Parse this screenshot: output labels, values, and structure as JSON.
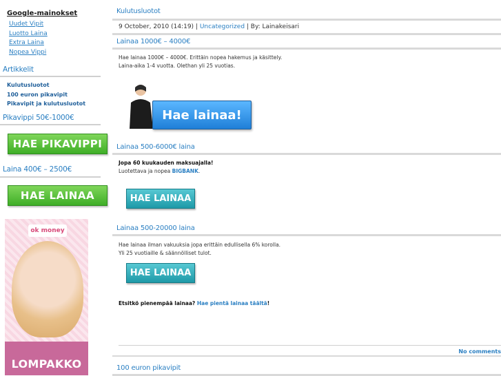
{
  "sidebar": {
    "ads_heading": "Google-mainokset",
    "ad_links": [
      "Uudet Vipit",
      "Luotto Laina",
      "Extra Laina",
      "Nopea Vippi"
    ],
    "articles_title": "Artikkelit",
    "articles": [
      "Kulutusluotot",
      "100 euron pikavipit",
      "Pikavipit ja kulutusluotot"
    ],
    "pikavippi_title": "Pikavippi 50€-1000€",
    "pikavippi_button": "HAE PIKAVIPPI",
    "laina_title": "Laina 400€ – 2500€",
    "laina_button": "HAE LAINAA",
    "banner_logo": "ok money",
    "banner_text": "LOMPAKKO"
  },
  "main": {
    "post_title": "Kulutusluotot",
    "meta_date": "9 October, 2010 (14:19) | ",
    "meta_category": "Uncategorized",
    "meta_author": " | By: Lainakeisari",
    "section1_title": "Lainaa 1000€ – 4000€",
    "section1_line1": "Hae lainaa 1000€ – 4000€. Erittäin nopea hakemus ja käsittely.",
    "section1_line2": "Laina-aika 1-4 vuotta. Olethan yli 25 vuotias.",
    "section1_button": "Hae lainaa!",
    "section2_title": "Lainaa 500-6000€ laina",
    "section2_line1": "Jopa 60 kuukauden maksuajalla!",
    "section2_line2_prefix": "Luotettava ja nopea ",
    "section2_brand": "BIGBANK",
    "section2_line2_suffix": ".",
    "section2_button": "HAE LAINAA",
    "section3_title": "Lainaa 500-20000 laina",
    "section3_line1": "Hae lainaa ilman vakuuksia jopa erittäin edullisella 6% korolla.",
    "section3_line2": "Yli 25 vuotiaille & säännölliset tulot.",
    "section3_button": "HAE LAINAA",
    "small_loan_question": "Etsitkö pienempää lainaa? ",
    "small_loan_link": "Hae pientä lainaa täältä",
    "small_loan_suffix": "!",
    "no_comments": "No comments",
    "next_post_title": "100 euron pikavipit"
  }
}
